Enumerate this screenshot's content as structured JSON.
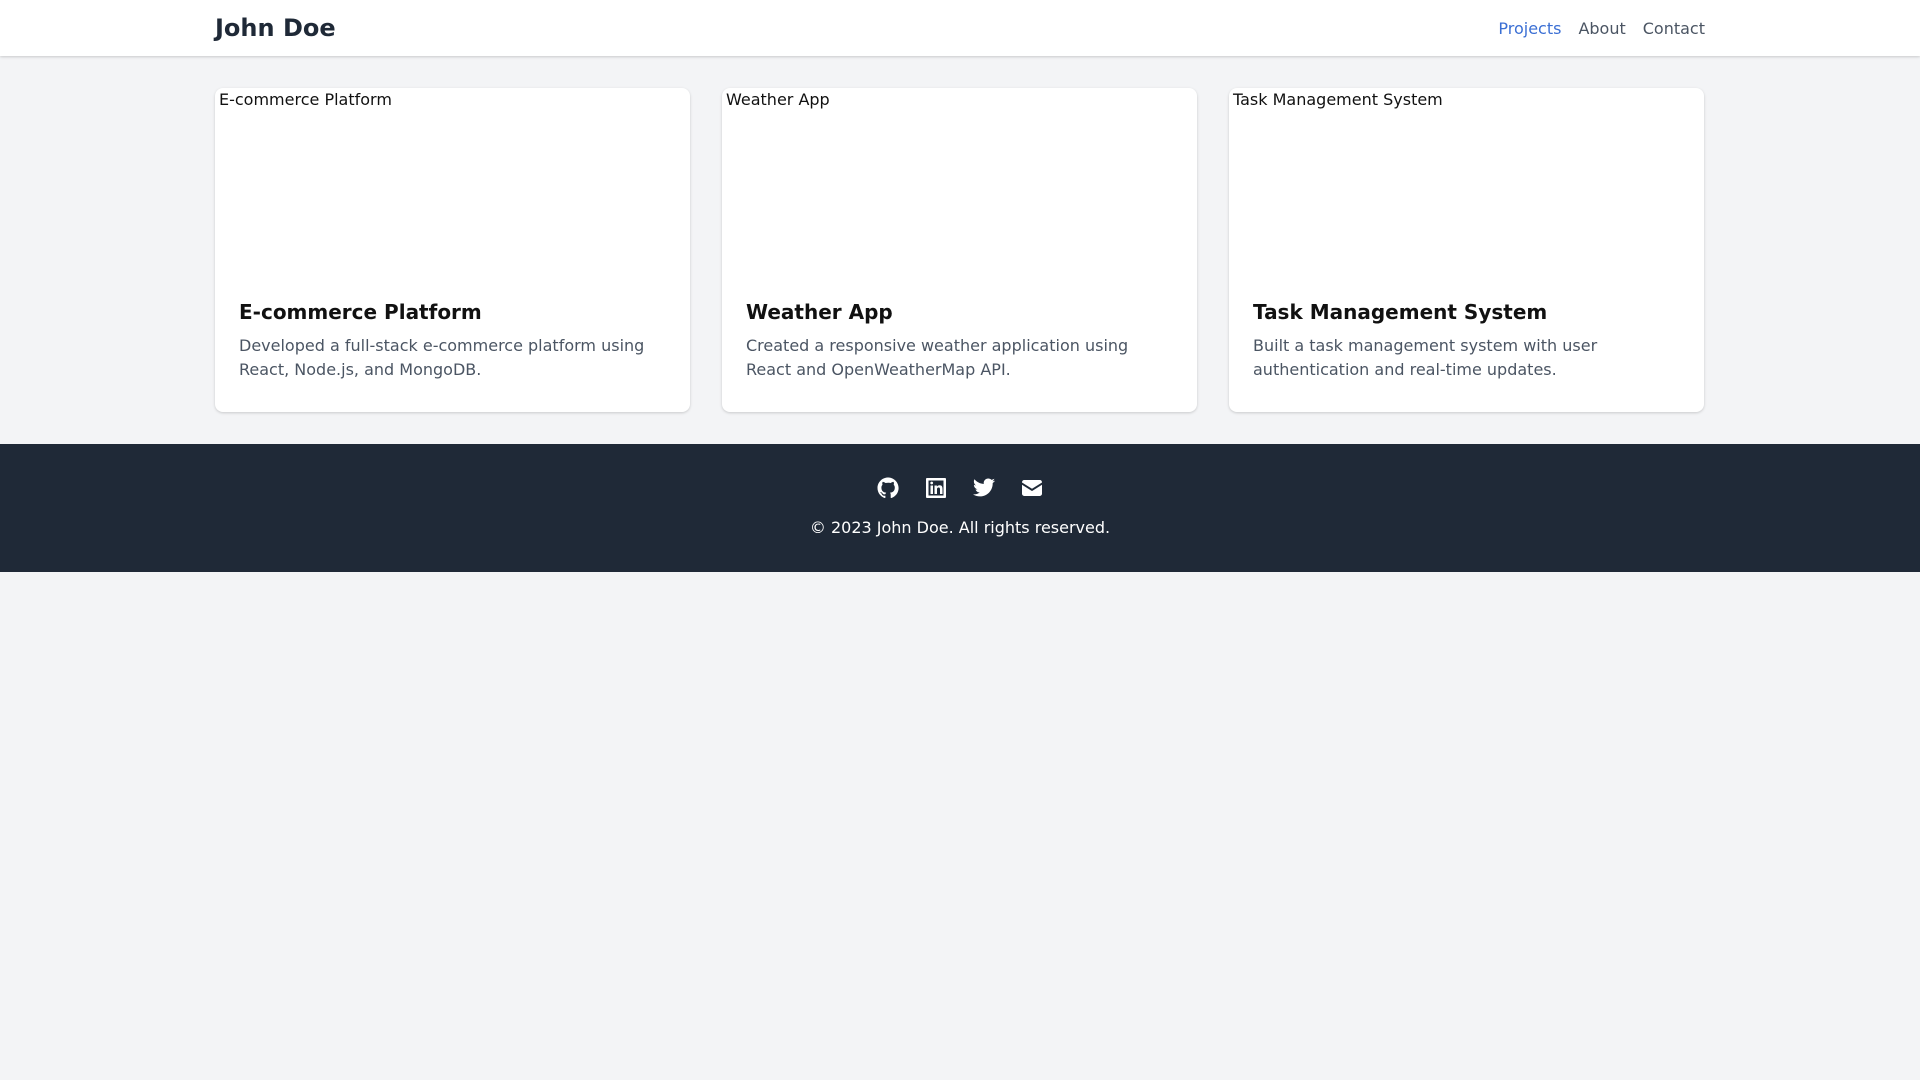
{
  "header": {
    "brand": "John Doe",
    "nav": [
      {
        "label": "Projects",
        "active": true
      },
      {
        "label": "About",
        "active": false
      },
      {
        "label": "Contact",
        "active": false
      }
    ]
  },
  "projects": [
    {
      "image_alt": "E-commerce Platform",
      "title": "E-commerce Platform",
      "description": "Developed a full-stack e-commerce platform using React, Node.js, and MongoDB."
    },
    {
      "image_alt": "Weather App",
      "title": "Weather App",
      "description": "Created a responsive weather application using React and OpenWeatherMap API."
    },
    {
      "image_alt": "Task Management System",
      "title": "Task Management System",
      "description": "Built a task management system with user authentication and real-time updates."
    }
  ],
  "footer": {
    "socials": [
      "github-icon",
      "linkedin-icon",
      "twitter-icon",
      "email-icon"
    ],
    "copyright": "© 2023 John Doe. All rights reserved."
  },
  "colors": {
    "accent": "#3b6fd4",
    "footer_bg": "#1f2937",
    "page_bg": "#f3f4f6"
  }
}
